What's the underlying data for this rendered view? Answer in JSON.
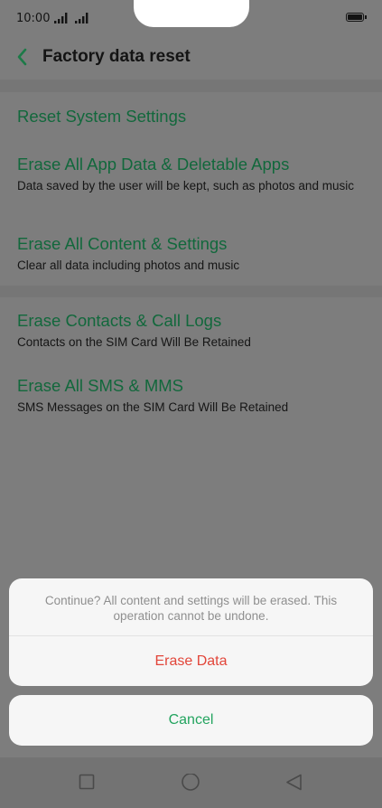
{
  "status_bar": {
    "time": "10:00"
  },
  "header": {
    "title": "Factory data reset",
    "back_icon": "chevron-left-icon"
  },
  "colors": {
    "accent_green": "#23a45f",
    "item_title_green": "#12683c",
    "danger_red": "#e2463a"
  },
  "group1": [
    {
      "title": "Reset System Settings",
      "subtitle": ""
    },
    {
      "title": "Erase All App Data & Deletable Apps",
      "subtitle": "Data saved by the user will be kept, such as photos and music"
    },
    {
      "title": "Erase All Content & Settings",
      "subtitle": "Clear all data including photos and music"
    }
  ],
  "group2": [
    {
      "title": "Erase Contacts & Call Logs",
      "subtitle": "Contacts on the SIM Card Will Be Retained"
    },
    {
      "title": "Erase All SMS & MMS",
      "subtitle": "SMS Messages on the SIM Card Will Be Retained"
    }
  ],
  "dialog": {
    "message": "Continue? All content and settings will be erased. This operation cannot be undone.",
    "confirm_label": "Erase Data",
    "cancel_label": "Cancel"
  },
  "nav_bar": {
    "icons": [
      "square-icon",
      "circle-icon",
      "triangle-back-icon"
    ]
  }
}
